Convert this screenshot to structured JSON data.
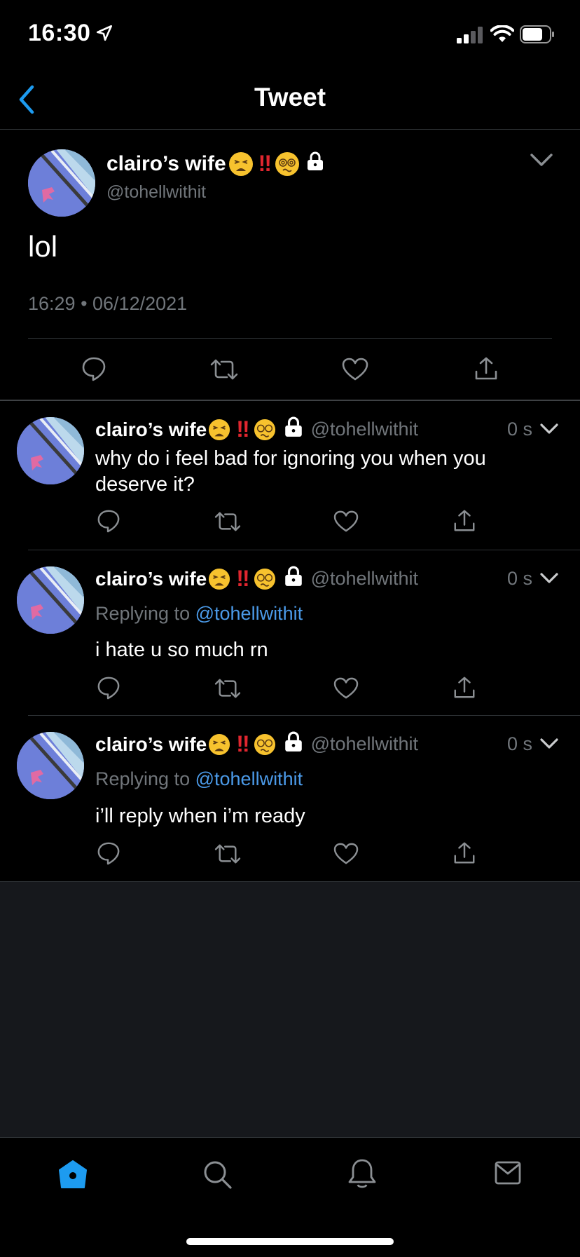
{
  "status_bar": {
    "time": "16:30"
  },
  "header": {
    "title": "Tweet"
  },
  "main_tweet": {
    "display_name": "clairo’s wife",
    "handle": "@tohellwithit",
    "text": "lol",
    "timestamp": "16:29 • 06/12/2021",
    "bang": "‼"
  },
  "replies": [
    {
      "display_name": "clairo’s wife",
      "handle": "@tohellwithit",
      "time": "0 s",
      "replying_prefix": "",
      "replying_to": "",
      "text_line1": "why do i feel bad for ignoring you when you",
      "text_line2": "deserve it?"
    },
    {
      "display_name": "clairo’s wife",
      "handle": "@tohellwithit",
      "time": "0 s",
      "replying_prefix": "Replying to",
      "replying_to": "@tohellwithit",
      "text_line1": "i hate u so much rn",
      "text_line2": ""
    },
    {
      "display_name": "clairo’s wife",
      "handle": "@tohellwithit",
      "time": "0 s",
      "replying_prefix": "Replying to",
      "replying_to": "@tohellwithit",
      "text_line1": "i’ll reply when i’m ready",
      "text_line2": ""
    }
  ],
  "tabbar": {
    "items": [
      "home-icon",
      "search-icon",
      "notifications-icon",
      "messages-icon"
    ],
    "active": "home-icon"
  },
  "colors": {
    "accent": "#1d9bf0",
    "muted": "#71767b",
    "mention": "#4b9ae8",
    "divider": "#2f3336",
    "empty_background": "#16181c"
  }
}
